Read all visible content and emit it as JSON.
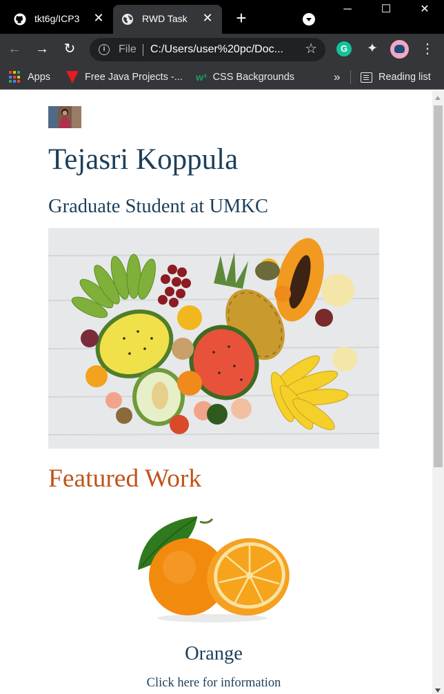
{
  "browser": {
    "tabs": [
      {
        "title": "tkt6g/ICP3",
        "favicon": "github-icon",
        "active": false
      },
      {
        "title": "RWD Task",
        "favicon": "globe-icon",
        "active": true
      }
    ],
    "new_tab_label": "+",
    "window_controls": {
      "minimize": "─",
      "maximize": "☐",
      "close": "✕"
    },
    "toolbar": {
      "scheme": "File",
      "url": "C:/Users/user%20pc/Doc..."
    },
    "extensions": {
      "grammarly": "G"
    },
    "bookmarks": [
      {
        "label": "Apps",
        "icon": "apps-grid-icon"
      },
      {
        "label": "Free Java Projects -...",
        "icon": "java-projects-icon"
      },
      {
        "label": "CSS Backgrounds",
        "icon": "w3schools-icon"
      }
    ],
    "overflow_label": "»",
    "reading_list_label": "Reading list"
  },
  "page": {
    "name": "Tejasri Koppula",
    "subtitle": "Graduate Student at UMKC",
    "featured_heading": "Featured Work",
    "work": {
      "title": "Orange",
      "link_text": "Click here for information"
    }
  },
  "colors": {
    "tab_strip": "#000000",
    "toolbar": "#35363a",
    "heading_blue": "#1c3f5a",
    "featured_orange": "#c0531c"
  }
}
